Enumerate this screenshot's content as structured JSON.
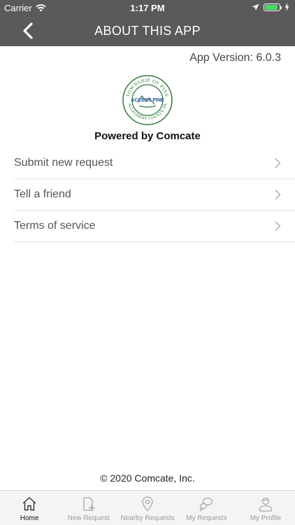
{
  "status_bar": {
    "carrier": "Carrier",
    "time": "1:17 PM",
    "battery_level": 0.9,
    "battery_color": "#4cd964"
  },
  "nav": {
    "title": "ABOUT THIS APP",
    "back_icon": "chevron-left-icon",
    "bar_color": "#5a5a5a"
  },
  "app_version": "App Version: 6.0.3",
  "logo": {
    "icon": "township-of-pine-seal",
    "seal_text_top": "TOWNSHIP OF PINE",
    "seal_text_bottom": "ALLEGHENY COUNTY, PA",
    "center_text": "ACCESS PINE"
  },
  "powered_by": "Powered by Comcate",
  "menu": [
    {
      "label": "Submit new request",
      "icon": "chevron-right-icon"
    },
    {
      "label": "Tell a friend",
      "icon": "chevron-right-icon"
    },
    {
      "label": "Terms of service",
      "icon": "chevron-right-icon"
    }
  ],
  "copyright": "© 2020 Comcate, Inc.",
  "tabs": [
    {
      "label": "Home",
      "icon": "home-icon",
      "active": true
    },
    {
      "label": "New Request",
      "icon": "new-request-icon",
      "active": false
    },
    {
      "label": "Nearby Requests",
      "icon": "map-pin-icon",
      "active": false
    },
    {
      "label": "My Requests",
      "icon": "chat-bubbles-icon",
      "active": false
    },
    {
      "label": "My Profile",
      "icon": "profile-icon",
      "active": false
    }
  ]
}
